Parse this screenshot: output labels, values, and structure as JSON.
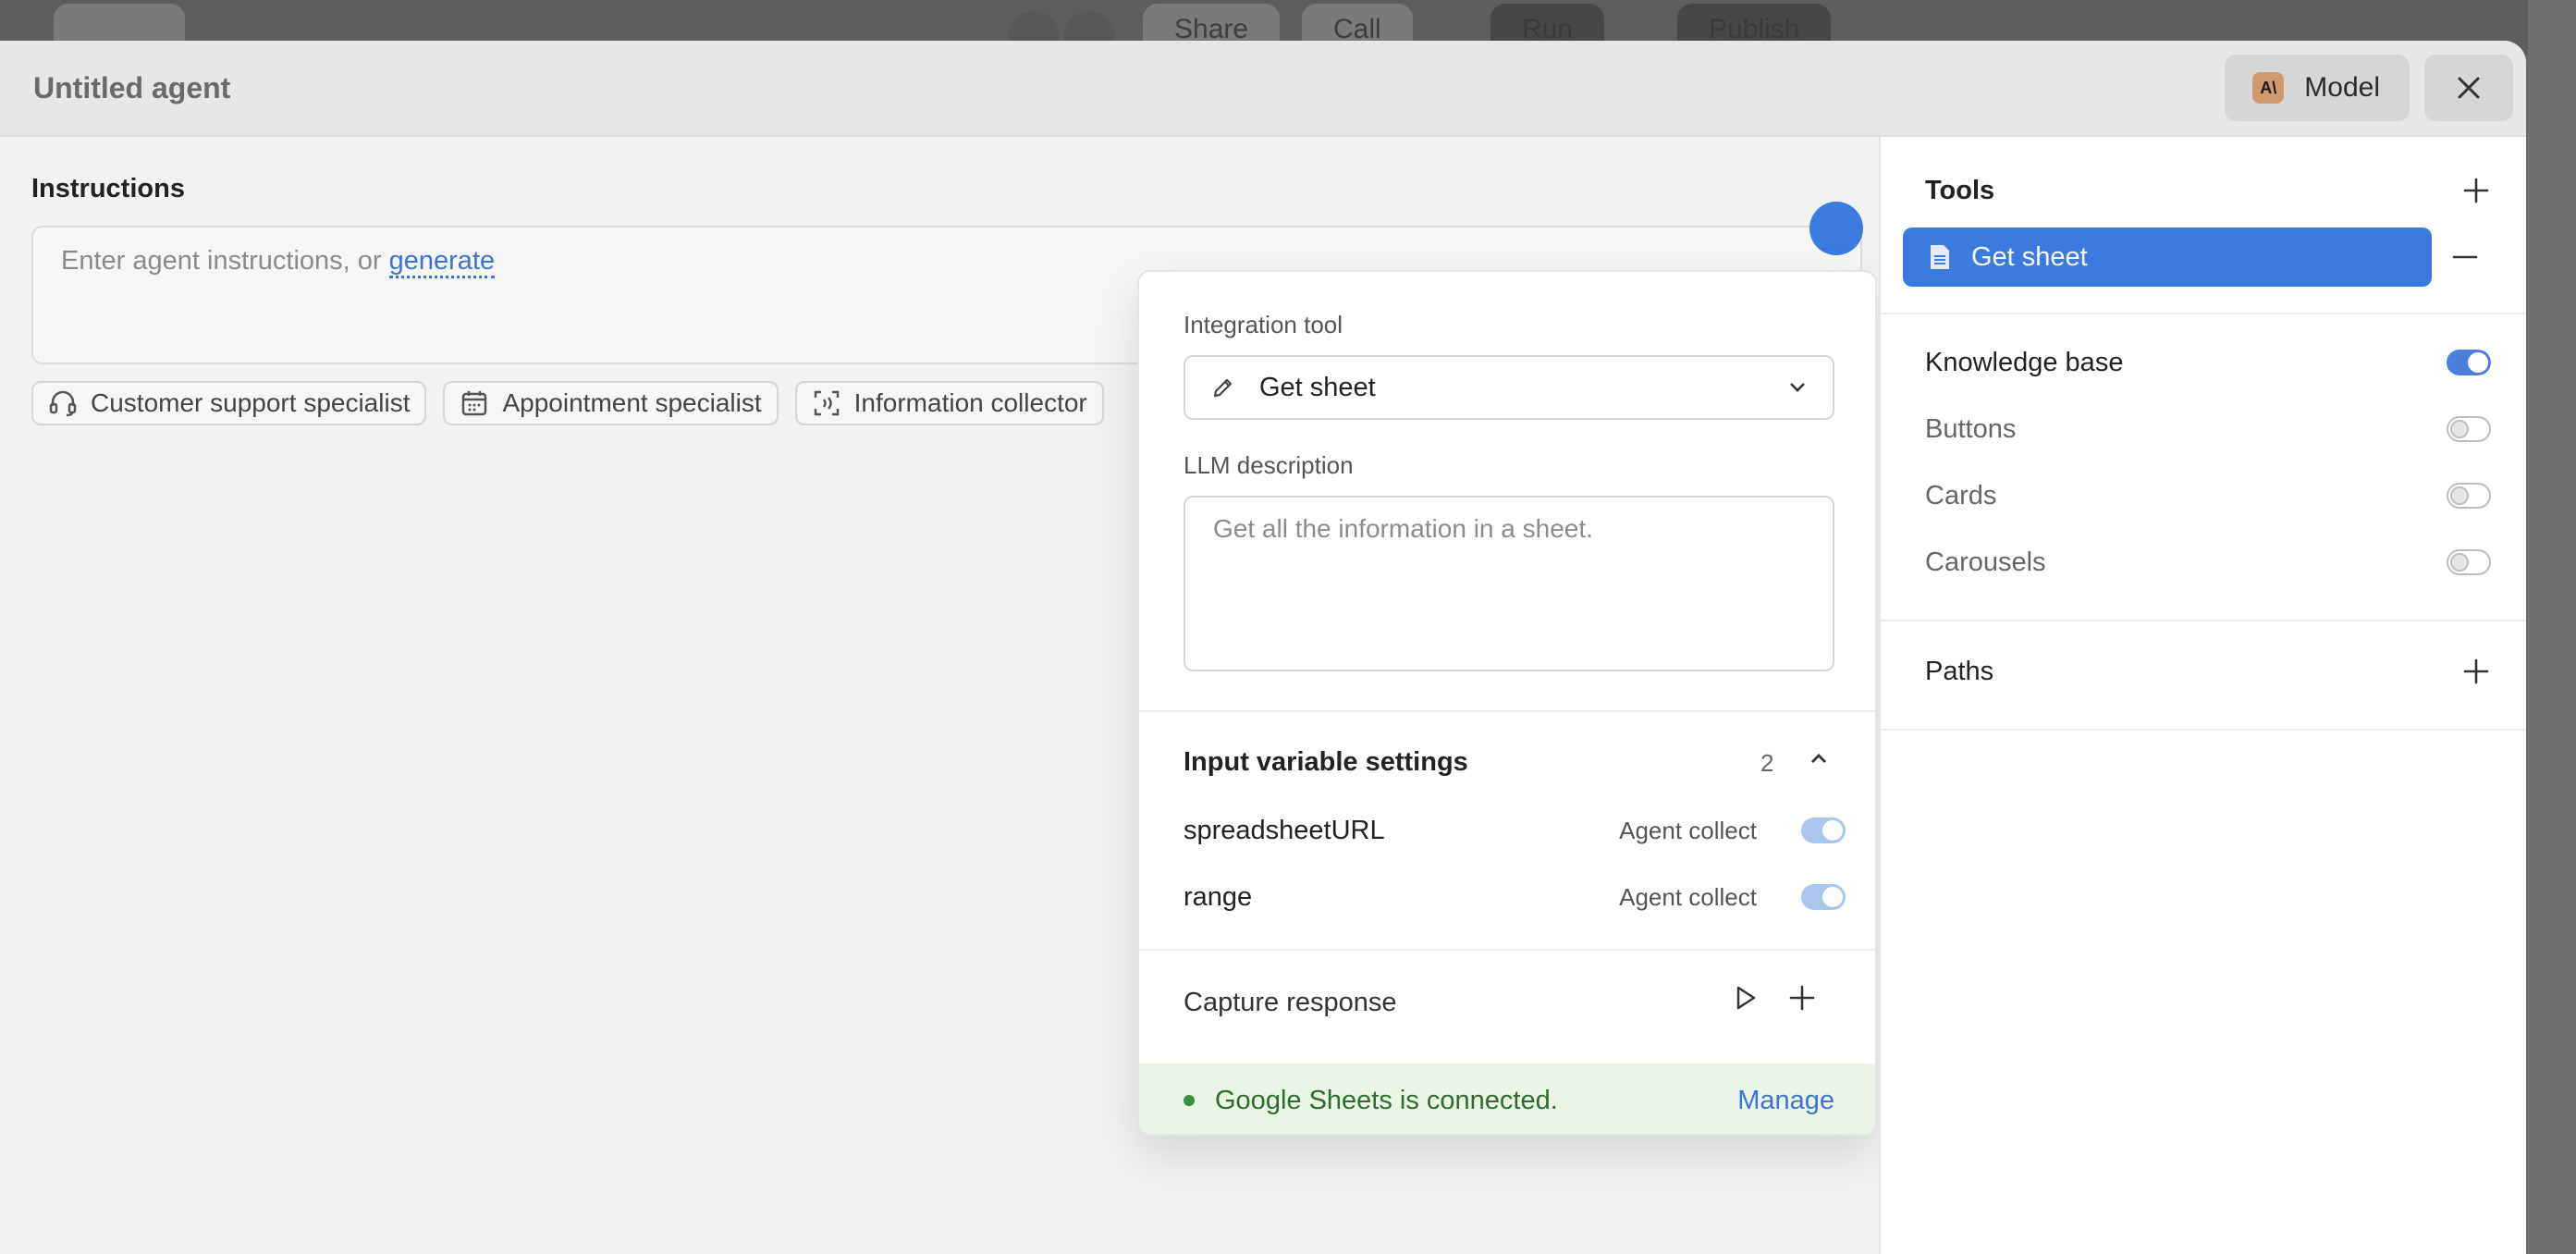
{
  "background": {
    "buttons": [
      "Share",
      "Call",
      "Run",
      "Publish"
    ]
  },
  "modal": {
    "title": "Untitled agent",
    "model_label": "Model",
    "model_icon_text": "A\\"
  },
  "instructions": {
    "label": "Instructions",
    "placeholder_prefix": "Enter agent instructions, or ",
    "generate_link": "generate"
  },
  "chips": [
    {
      "label": "Customer support specialist",
      "icon": "headset-icon"
    },
    {
      "label": "Appointment specialist",
      "icon": "calendar-icon"
    },
    {
      "label": "Information collector",
      "icon": "scan-icon"
    }
  ],
  "popover": {
    "integration_tool_label": "Integration tool",
    "integration_tool_value": "Get sheet",
    "llm_description_label": "LLM description",
    "llm_description_placeholder": "Get all the information in a sheet.",
    "input_variables": {
      "title": "Input variable settings",
      "count": "2",
      "items": [
        {
          "name": "spreadsheetURL",
          "mode": "Agent collect"
        },
        {
          "name": "range",
          "mode": "Agent collect"
        }
      ]
    },
    "capture_response_label": "Capture response",
    "status": {
      "text": "Google Sheets is connected.",
      "manage_label": "Manage"
    }
  },
  "right_panel": {
    "tools_label": "Tools",
    "selected_tool": "Get sheet",
    "toggles": [
      {
        "label": "Knowledge base",
        "on": true
      },
      {
        "label": "Buttons",
        "on": false
      },
      {
        "label": "Cards",
        "on": false
      },
      {
        "label": "Carousels",
        "on": false
      }
    ],
    "paths_label": "Paths"
  },
  "colors": {
    "accent": "#3a7be0",
    "link": "#3e73d6",
    "success_bg": "#eaf5e6",
    "success_text": "#2f6b2f"
  }
}
